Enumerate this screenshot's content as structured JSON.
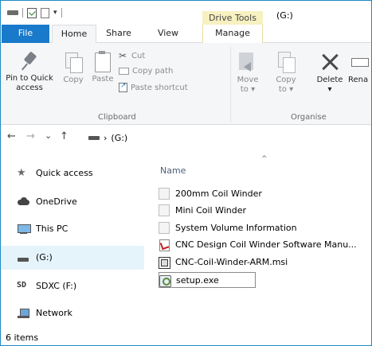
{
  "titlebar": {
    "context_tab": "Drive Tools",
    "title": "(G:)",
    "qat_dropdown": "▾"
  },
  "tabs": {
    "file": "File",
    "home": "Home",
    "share": "Share",
    "view": "View",
    "manage": "Manage"
  },
  "ribbon": {
    "pin_quick_access_line1": "Pin to Quick",
    "pin_quick_access_line2": "access",
    "copy": "Copy",
    "paste": "Paste",
    "cut": "Cut",
    "copy_path": "Copy path",
    "paste_shortcut": "Paste shortcut",
    "clipboard_group": "Clipboard",
    "move_to_line1": "Move",
    "move_to_line2": "to ▾",
    "copy_to_line1": "Copy",
    "copy_to_line2": "to ▾",
    "delete_line1": "Delete",
    "delete_line2": "▾",
    "rename": "Rena",
    "organise_group": "Organise"
  },
  "navbar": {
    "back": "←",
    "forward": "→",
    "recent": "⌄",
    "up": "↑",
    "path_separator": "›",
    "path": "(G:)"
  },
  "navpane": {
    "items": [
      {
        "label": "Quick access",
        "icon": "star-icon"
      },
      {
        "label": "OneDrive",
        "icon": "cloud-icon"
      },
      {
        "label": "This PC",
        "icon": "computer-icon"
      },
      {
        "label": "(G:)",
        "icon": "drive-icon",
        "selected": true
      },
      {
        "label": "SDXC (F:)",
        "icon": "sd-card-icon"
      },
      {
        "label": "Network",
        "icon": "network-icon"
      }
    ]
  },
  "filelist": {
    "column_name": "Name",
    "sort_indicator": "^",
    "files": [
      {
        "name": "200mm Coil Winder",
        "icon": "folder-icon"
      },
      {
        "name": "Mini Coil Winder",
        "icon": "folder-icon"
      },
      {
        "name": "System Volume Information",
        "icon": "folder-icon"
      },
      {
        "name": "CNC Design  Coil Winder Software Manu...",
        "icon": "pdf-icon"
      },
      {
        "name": "CNC-Coil-Winder-ARM.msi",
        "icon": "msi-icon"
      },
      {
        "name": "setup.exe",
        "icon": "exe-icon",
        "selected": true
      }
    ]
  },
  "statusbar": {
    "item_count": "6 items"
  }
}
